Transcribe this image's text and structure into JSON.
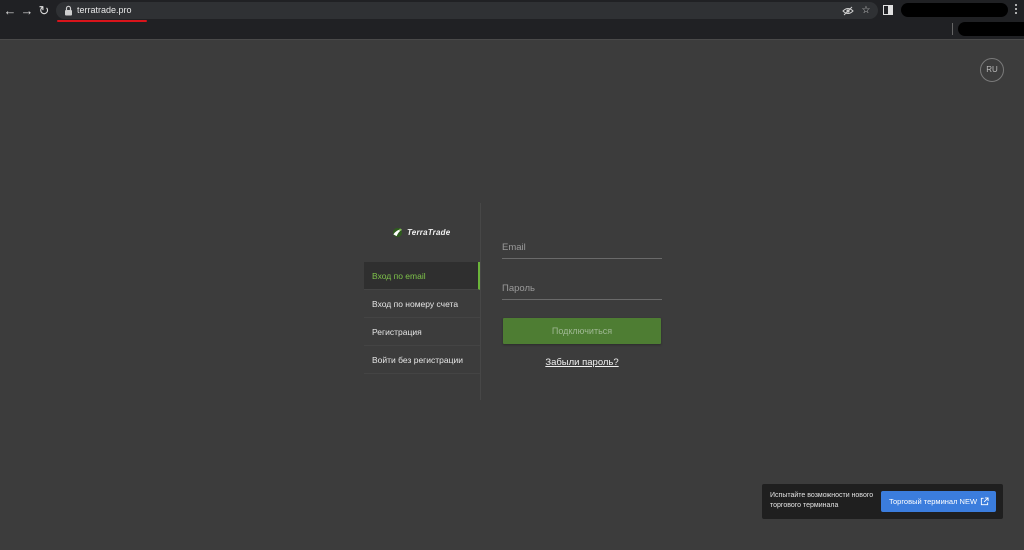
{
  "browser": {
    "url": "terratrade.pro",
    "back_icon": "←",
    "forward_icon": "→",
    "reload_icon": "↻",
    "star_icon": "☆"
  },
  "lang": {
    "label": "RU"
  },
  "brand": {
    "name": "TerraTrade"
  },
  "menu": {
    "items": [
      {
        "label": "Вход по email"
      },
      {
        "label": "Вход по номеру счета"
      },
      {
        "label": "Регистрация"
      },
      {
        "label": "Войти без регистрации"
      }
    ]
  },
  "form": {
    "email_placeholder": "Email",
    "password_placeholder": "Пароль",
    "submit_label": "Подключиться",
    "forgot_label": "Забыли пароль?"
  },
  "promo": {
    "text": "Испытайте возможности нового торгового терминала",
    "button_label": "Торговый терминал NEW"
  },
  "colors": {
    "accent_green": "#6bb43a",
    "button_green": "#4e7d33",
    "promo_blue": "#3b7ddd",
    "url_underline": "#d8141b"
  }
}
